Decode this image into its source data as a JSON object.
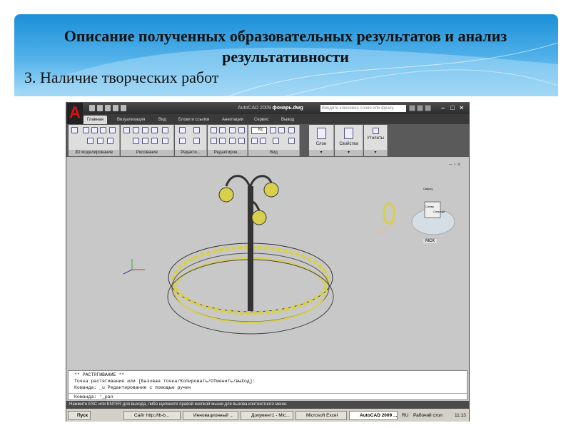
{
  "slide": {
    "title": "Описание полученных образовательных результатов и анализ результативности",
    "subtitle": "3. Наличие творческих работ"
  },
  "app": {
    "name": "AutoCAD 2009",
    "file": "фонарь.dwg",
    "search_placeholder": "Введите ключевое слово или фразу",
    "tabs": [
      "Главная",
      "Визуализация",
      "Вид",
      "Блоки и ссылки",
      "Аннотации",
      "Сервис",
      "Вывод"
    ],
    "panels": [
      "3D моделирование",
      "Рисование",
      "Редакти...",
      "Редактиров...",
      "Вид",
      "Слои",
      "Свойства",
      "Утилиты"
    ],
    "view_style": "Кс",
    "ucs_label": "МСК",
    "viewcube": {
      "top": "Сверху",
      "front": "Слева",
      "right": "Спереди"
    },
    "command_history": [
      "** РАСТЯГИВАНИЕ **",
      "Точка растягивания или [Базовая точка/Копировать/ОТменить/выХод]:",
      "Команда:  _u Редактирование с помощью ручек"
    ],
    "command_line": "Команда: '_pan",
    "status": "Нажмите ESC или ENTER для выхода, либо щелкните правой кнопкой мыши для вызова контекстного меню."
  },
  "taskbar": {
    "start": "Пуск",
    "items": [
      "Сайт http://lb-b...",
      "Инновационный ...",
      "Документ1 - Mic...",
      "Microsoft Excel",
      "AutoCAD 2009 ..."
    ],
    "active": 4,
    "lang": "RU",
    "desktop": "Рабочий стол",
    "time": "11:13"
  },
  "colors": {
    "accent": "#1b8fd8",
    "viewport": "#c8c8c8",
    "model": "#d8cf4a"
  }
}
